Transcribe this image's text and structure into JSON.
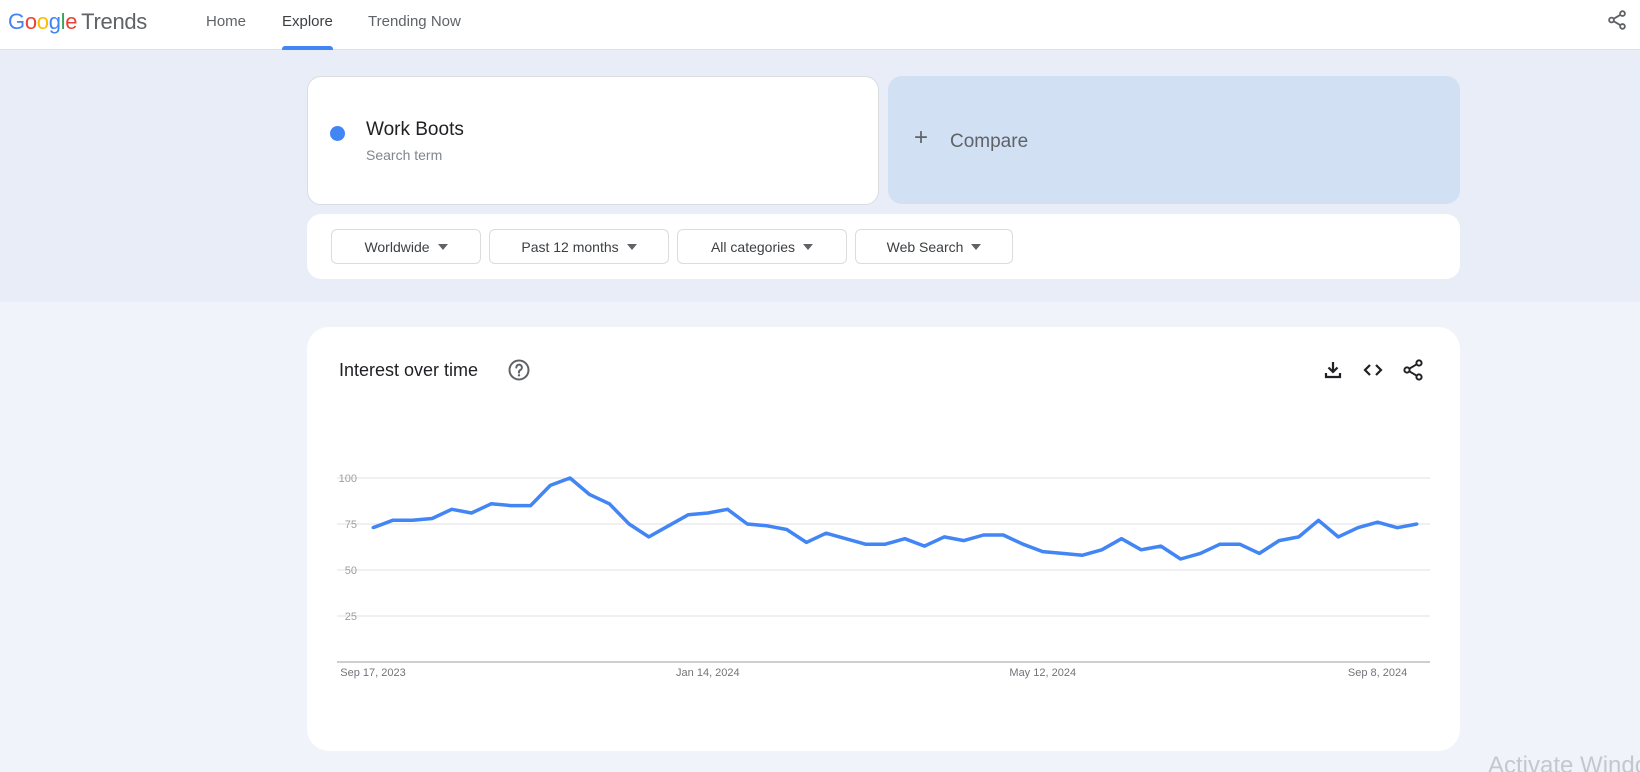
{
  "app": {
    "logo_parts": [
      "G",
      "o",
      "o",
      "g",
      "l",
      "e"
    ],
    "logo_suffix": "Trends"
  },
  "nav": {
    "tabs": [
      {
        "label": "Home",
        "active": false
      },
      {
        "label": "Explore",
        "active": true
      },
      {
        "label": "Trending Now",
        "active": false
      }
    ],
    "share_icon": "share-icon"
  },
  "search": {
    "term": "Work Boots",
    "term_type": "Search term",
    "term_color": "#4285f4",
    "compare_icon": "plus-icon",
    "compare_label": "Compare"
  },
  "filters": [
    {
      "label": "Worldwide"
    },
    {
      "label": "Past 12 months"
    },
    {
      "label": "All categories"
    },
    {
      "label": "Web Search"
    }
  ],
  "card": {
    "title": "Interest over time",
    "help_icon": "help-circle-icon",
    "actions": [
      "download-icon",
      "embed-code-icon",
      "share-icon"
    ]
  },
  "watermark": "Activate Windows",
  "chart_data": {
    "type": "line",
    "title": "Interest over time",
    "xlabel": "",
    "ylabel": "",
    "ylim": [
      0,
      100
    ],
    "yticks": [
      25,
      50,
      75,
      100
    ],
    "grid": true,
    "x_tick_labels": [
      "Sep 17, 2023",
      "Jan 14, 2024",
      "May 12, 2024",
      "Sep 8, 2024"
    ],
    "x_start": "Sep 17, 2023",
    "x_end": "Sep 8, 2024",
    "interval": "weekly",
    "series": [
      {
        "name": "Work Boots",
        "color": "#4285f4",
        "values": [
          73,
          77,
          77,
          78,
          83,
          81,
          86,
          85,
          85,
          96,
          100,
          91,
          86,
          75,
          68,
          74,
          80,
          81,
          83,
          75,
          74,
          72,
          65,
          70,
          67,
          64,
          64,
          67,
          63,
          68,
          66,
          69,
          69,
          64,
          60,
          59,
          58,
          61,
          67,
          61,
          63,
          56,
          59,
          64,
          64,
          59,
          66,
          68,
          77,
          68,
          73,
          76,
          73,
          75
        ]
      }
    ]
  }
}
